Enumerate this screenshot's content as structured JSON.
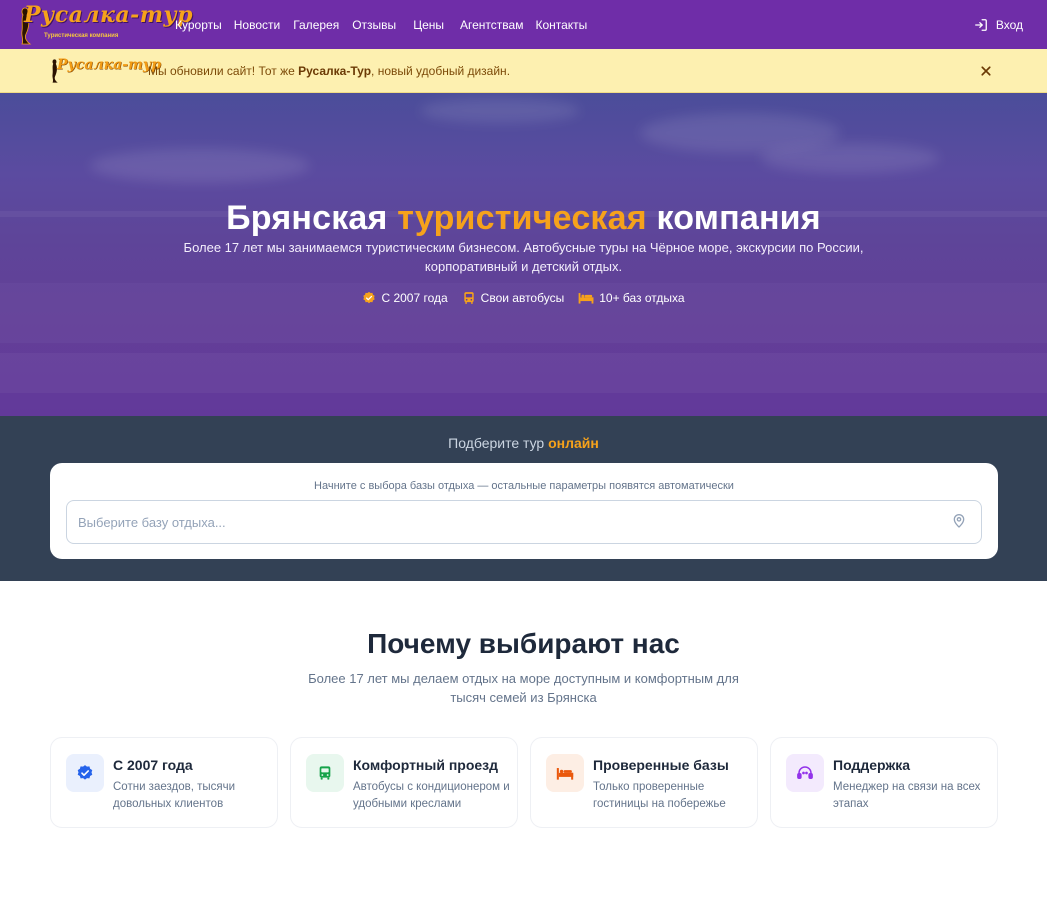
{
  "nav": {
    "logo_text": "Русалка-тур",
    "logo_tagline": "Туристическая компания",
    "links": [
      "Курорты",
      "Новости",
      "Галерея",
      "Отзывы",
      "Цены",
      "Агентствам",
      "Контакты"
    ],
    "login_label": "Вход"
  },
  "banner": {
    "logo_text": "Русалка-тур",
    "text_before": "Мы обновили сайт! Тот же ",
    "brand": "Русалка-Тур",
    "text_after": ", новый удобный дизайн."
  },
  "hero": {
    "title_part1": "Брянская ",
    "title_accent": "туристическая",
    "title_part2": " компания",
    "subtitle": "Более 17 лет мы занимаемся туристическим бизнесом. Автобусные туры на Чёрное море, экскурсии по России, корпоративный и детский отдых.",
    "features": [
      {
        "icon": "verified-badge-icon",
        "label": "С 2007 года"
      },
      {
        "icon": "bus-icon",
        "label": "Свои автобусы"
      },
      {
        "icon": "bed-icon",
        "label": "10+ баз отдыха"
      }
    ]
  },
  "search": {
    "heading_part1": "Подберите тур ",
    "heading_accent": "онлайн",
    "hint": "Начните с выбора базы отдыха — остальные параметры появятся автоматически",
    "placeholder": "Выберите базу отдыха..."
  },
  "why": {
    "title": "Почему выбирают нас",
    "subtitle": "Более 17 лет мы делаем отдых на море доступным и комфортным для тысяч семей из Брянска",
    "cards": [
      {
        "icon": "verified-badge-icon",
        "title": "С 2007 года",
        "text": "Сотни заездов, тысячи довольных клиентов"
      },
      {
        "icon": "bus-icon",
        "title": "Комфортный проезд",
        "text": "Автобусы с кондиционером и удобными креслами"
      },
      {
        "icon": "bed-icon",
        "title": "Проверенные базы",
        "text": "Только проверенные гостиницы на побережье"
      },
      {
        "icon": "support-agent-icon",
        "title": "Поддержка",
        "text": "Менеджер на связи на всех этапах"
      }
    ]
  },
  "colors": {
    "nav_bg": "#6f2da8",
    "accent": "#f6a21b",
    "banner_bg": "#fdf0b0",
    "search_bg": "#334155"
  }
}
